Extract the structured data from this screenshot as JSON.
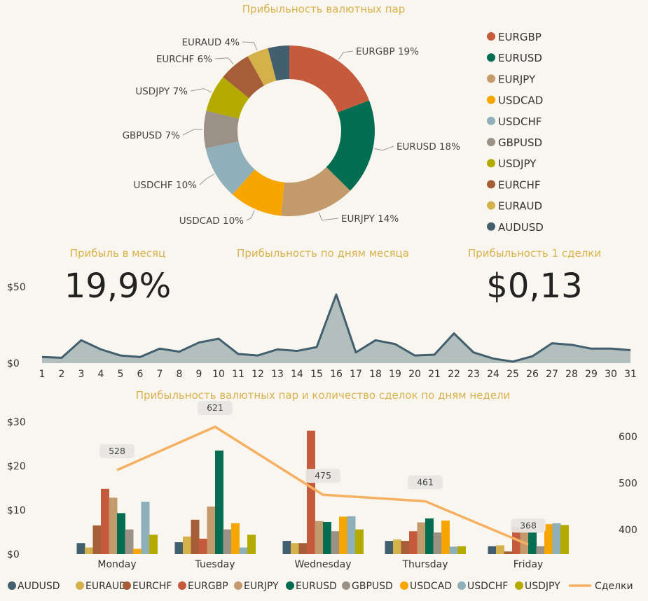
{
  "colors": {
    "AUDUSD": "#415f6e",
    "EURAUD": "#d4b14a",
    "EURCHF": "#a55e38",
    "EURGBP": "#c55a3c",
    "EURJPY": "#c29a6c",
    "EURUSD": "#046d52",
    "GBPUSD": "#9c9186",
    "USDCAD": "#f7a500",
    "USDCHF": "#8fb0ba",
    "USDJPY": "#b5aa00",
    "deals_line": "#f6b062",
    "area_fill": "#b3bfbd",
    "area_line": "#415f6e"
  },
  "pie": {
    "title": "Прибыльность валютных пар",
    "slices": [
      {
        "name": "EURGBP",
        "pct": 19,
        "label": "EURGBP 19%"
      },
      {
        "name": "EURUSD",
        "pct": 18,
        "label": "EURUSD 18%"
      },
      {
        "name": "EURJPY",
        "pct": 14,
        "label": "EURJPY 14%"
      },
      {
        "name": "USDCAD",
        "pct": 10,
        "label": "USDCAD 10%"
      },
      {
        "name": "USDCHF",
        "pct": 10,
        "label": "USDCHF 10%"
      },
      {
        "name": "GBPUSD",
        "pct": 7,
        "label": "GBPUSD 7%"
      },
      {
        "name": "USDJPY",
        "pct": 7,
        "label": "USDJPY 7%"
      },
      {
        "name": "EURCHF",
        "pct": 6,
        "label": "EURCHF 6%"
      },
      {
        "name": "EURAUD",
        "pct": 4,
        "label": "EURAUD 4%"
      },
      {
        "name": "AUDUSD",
        "pct": 4,
        "label": ""
      }
    ],
    "legend": [
      "EURGBP",
      "EURUSD",
      "EURJPY",
      "USDCAD",
      "USDCHF",
      "GBPUSD",
      "USDJPY",
      "EURCHF",
      "EURAUD",
      "AUDUSD"
    ]
  },
  "kpi": {
    "left_title": "Прибыль в месяц",
    "left_value": "19,9%",
    "right_title": "Прибыльность 1 сделки",
    "right_value": "$0,13"
  },
  "chart_data": [
    {
      "type": "pie",
      "title": "Прибыльность валютных пар",
      "categories": [
        "EURGBP",
        "EURUSD",
        "EURJPY",
        "USDCAD",
        "USDCHF",
        "GBPUSD",
        "USDJPY",
        "EURCHF",
        "EURAUD",
        "AUDUSD"
      ],
      "values": [
        19,
        18,
        14,
        10,
        10,
        7,
        7,
        6,
        4,
        4
      ]
    },
    {
      "type": "area",
      "title": "Прибыльность по дням месяца",
      "x": [
        1,
        2,
        3,
        4,
        5,
        6,
        7,
        8,
        9,
        10,
        11,
        12,
        13,
        14,
        15,
        16,
        17,
        18,
        19,
        20,
        21,
        22,
        23,
        24,
        25,
        26,
        27,
        28,
        29,
        30,
        31
      ],
      "values": [
        4,
        3.5,
        15,
        9,
        5,
        4,
        9.5,
        7.5,
        13.5,
        16,
        6,
        5,
        9,
        8,
        10.5,
        45,
        7,
        15,
        12.5,
        5,
        5.5,
        19.5,
        7,
        3,
        1,
        4.5,
        13,
        12,
        9.5,
        9.5,
        8.5
      ],
      "ylim": [
        0,
        50
      ],
      "yticks": [
        "$0",
        "$50"
      ]
    },
    {
      "type": "bar",
      "title": "Прибыльность валютных пар и количество сделок по дням недели",
      "categories": [
        "Monday",
        "Tuesday",
        "Wednesday",
        "Thursday",
        "Friday"
      ],
      "ylim": [
        0,
        30
      ],
      "yticks": [
        "$0",
        "$10",
        "$20",
        "$30"
      ],
      "y2ticks": [
        "400",
        "500",
        "600"
      ],
      "y2lim": [
        350,
        640
      ],
      "series": [
        {
          "name": "AUDUSD",
          "values": [
            2.5,
            2.7,
            3,
            3,
            1.8
          ]
        },
        {
          "name": "EURAUD",
          "values": [
            1.5,
            4,
            2.5,
            3.3,
            2
          ]
        },
        {
          "name": "EURCHF",
          "values": [
            6.5,
            7.8,
            2.5,
            3,
            0.6
          ]
        },
        {
          "name": "EURGBP",
          "values": [
            14.8,
            3.5,
            28,
            5.2,
            6.2
          ]
        },
        {
          "name": "EURJPY",
          "values": [
            12.8,
            10.8,
            7.5,
            7.2,
            6
          ]
        },
        {
          "name": "EURUSD",
          "values": [
            9.3,
            23.5,
            7.3,
            8.1,
            5
          ]
        },
        {
          "name": "GBPUSD",
          "values": [
            5.6,
            5.6,
            5.2,
            4.9,
            1.8
          ]
        },
        {
          "name": "USDCAD",
          "values": [
            1.2,
            7,
            8.5,
            7.6,
            6.8
          ]
        },
        {
          "name": "USDCHF",
          "values": [
            11.9,
            1.5,
            8.6,
            1.7,
            7
          ]
        },
        {
          "name": "USDJPY",
          "values": [
            4.4,
            4.4,
            5.6,
            1.8,
            6.6
          ]
        }
      ],
      "line": {
        "name": "Сделки",
        "values": [
          528,
          621,
          475,
          461,
          368
        ]
      }
    }
  ]
}
